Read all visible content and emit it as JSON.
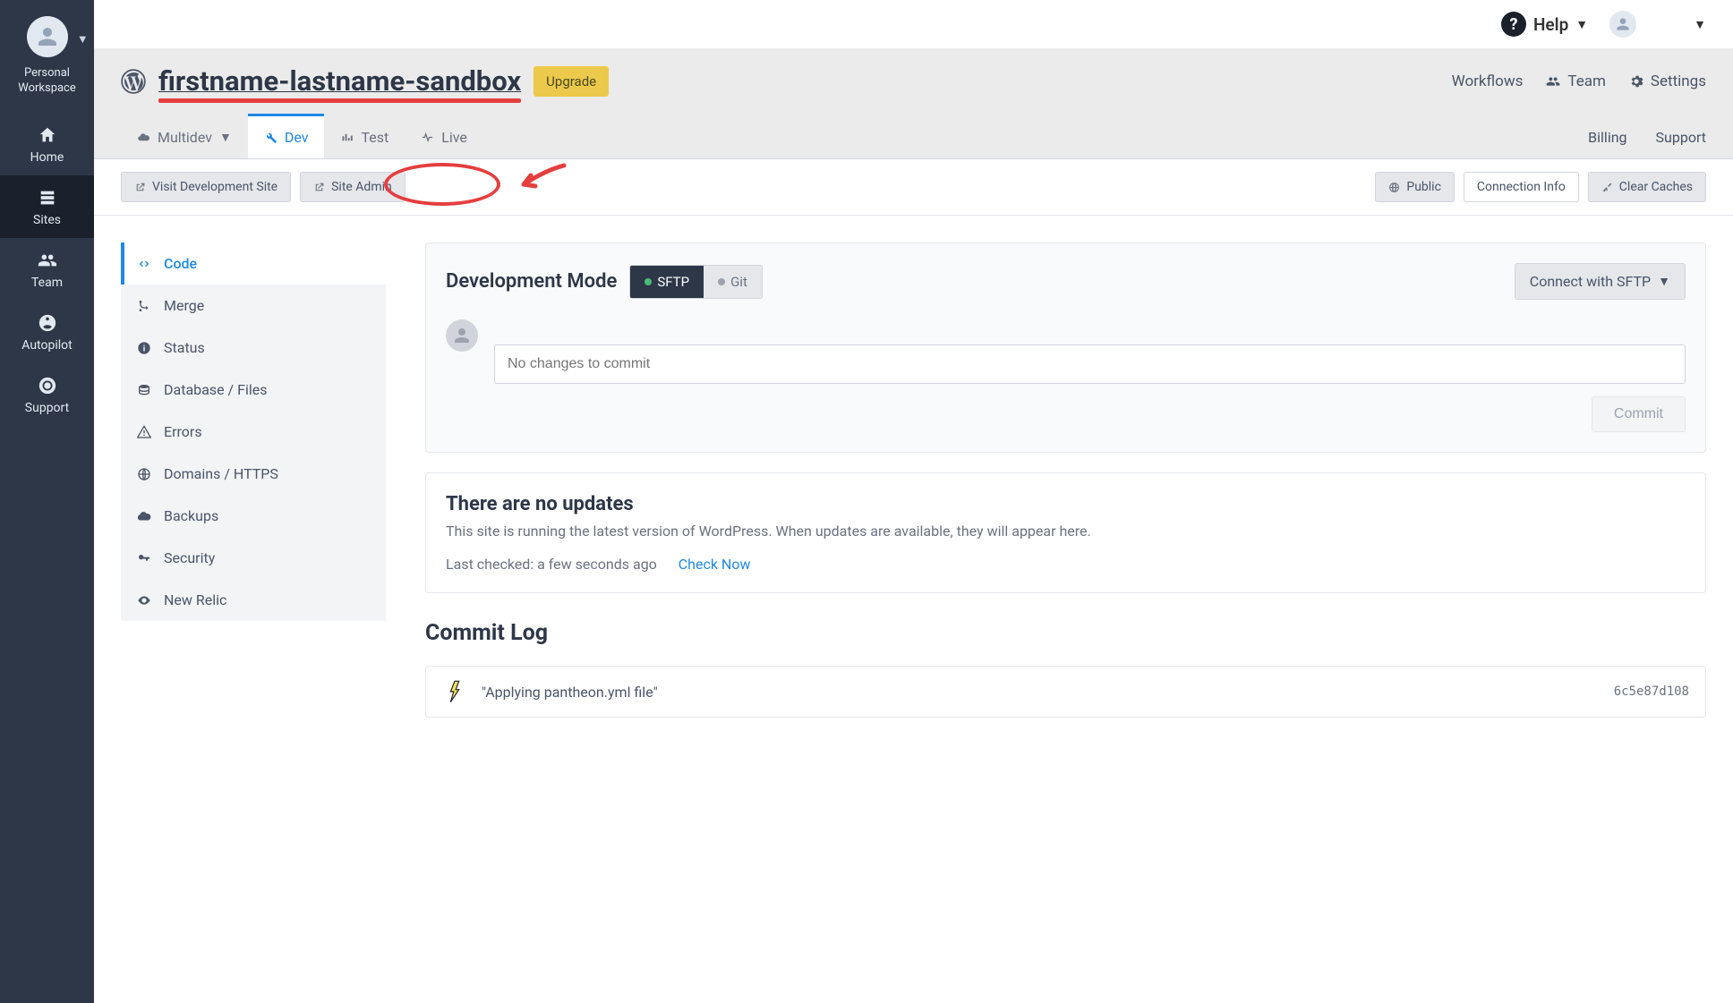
{
  "leftnav": {
    "workspace": "Personal\nWorkspace",
    "items": [
      {
        "label": "Home"
      },
      {
        "label": "Sites"
      },
      {
        "label": "Team"
      },
      {
        "label": "Autopilot"
      },
      {
        "label": "Support"
      }
    ]
  },
  "topbar": {
    "help": "Help"
  },
  "site": {
    "name": "firstname-lastname-sandbox",
    "upgrade": "Upgrade",
    "workflows": "Workflows",
    "team": "Team",
    "settings": "Settings"
  },
  "envtabs": {
    "multidev": "Multidev",
    "dev": "Dev",
    "test": "Test",
    "live": "Live",
    "billing": "Billing",
    "support": "Support"
  },
  "actions": {
    "visit": "Visit Development Site",
    "admin": "Site Admin",
    "public": "Public",
    "conninfo": "Connection Info",
    "clear": "Clear Caches"
  },
  "sidemenu": {
    "code": "Code",
    "merge": "Merge",
    "status": "Status",
    "db": "Database / Files",
    "errors": "Errors",
    "domains": "Domains / HTTPS",
    "backups": "Backups",
    "security": "Security",
    "newrelic": "New Relic"
  },
  "devmode": {
    "title": "Development Mode",
    "sftp": "SFTP",
    "git": "Git",
    "connect": "Connect with SFTP",
    "author_line": "< >",
    "placeholder": "No changes to commit",
    "commit_btn": "Commit"
  },
  "updates": {
    "title": "There are no updates",
    "desc": "This site is running the latest version of WordPress. When updates are available, they will appear here.",
    "lastcheck": "Last checked: a few seconds ago",
    "checknow": "Check Now"
  },
  "commitlog": {
    "title": "Commit Log",
    "entry_msg": "\"Applying pantheon.yml file\"",
    "entry_hash": "6c5e87d108"
  }
}
